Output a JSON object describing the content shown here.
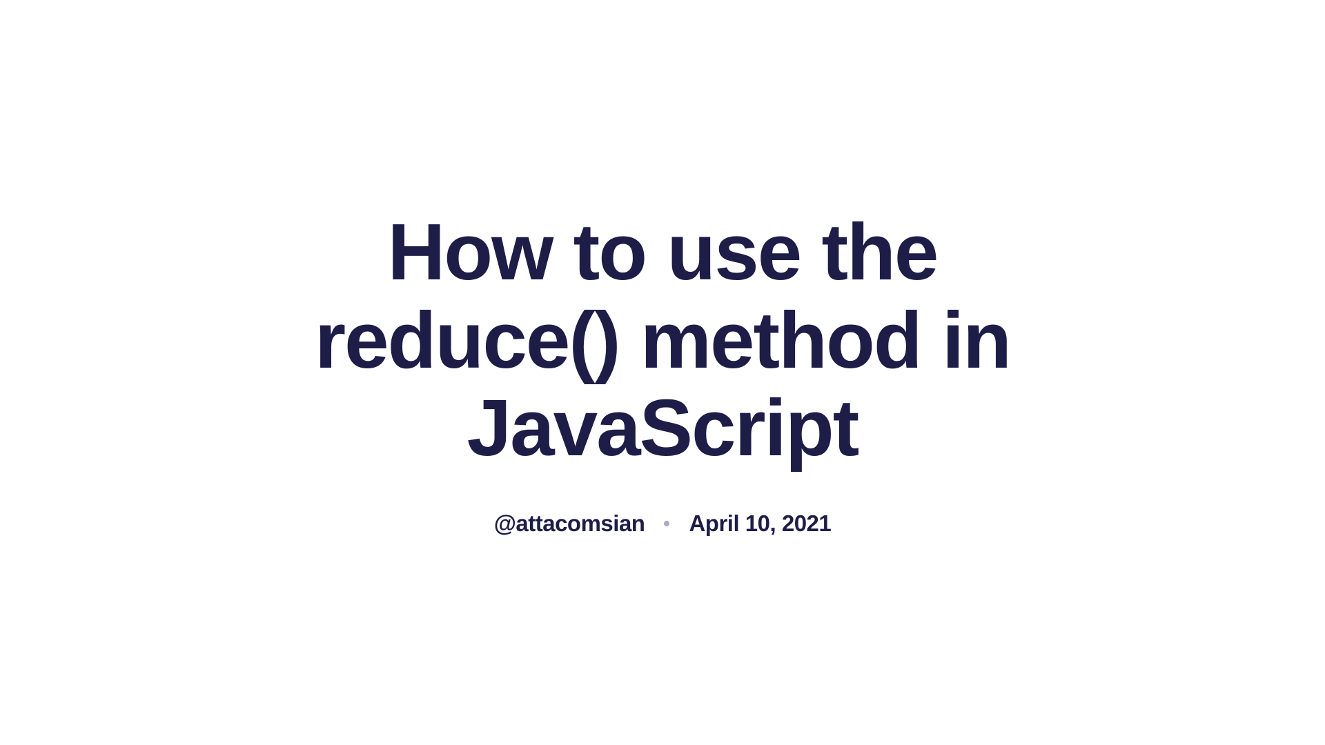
{
  "article": {
    "title": "How to use the reduce() method in JavaScript",
    "author_handle": "@attacomsian",
    "date": "April 10, 2021"
  }
}
